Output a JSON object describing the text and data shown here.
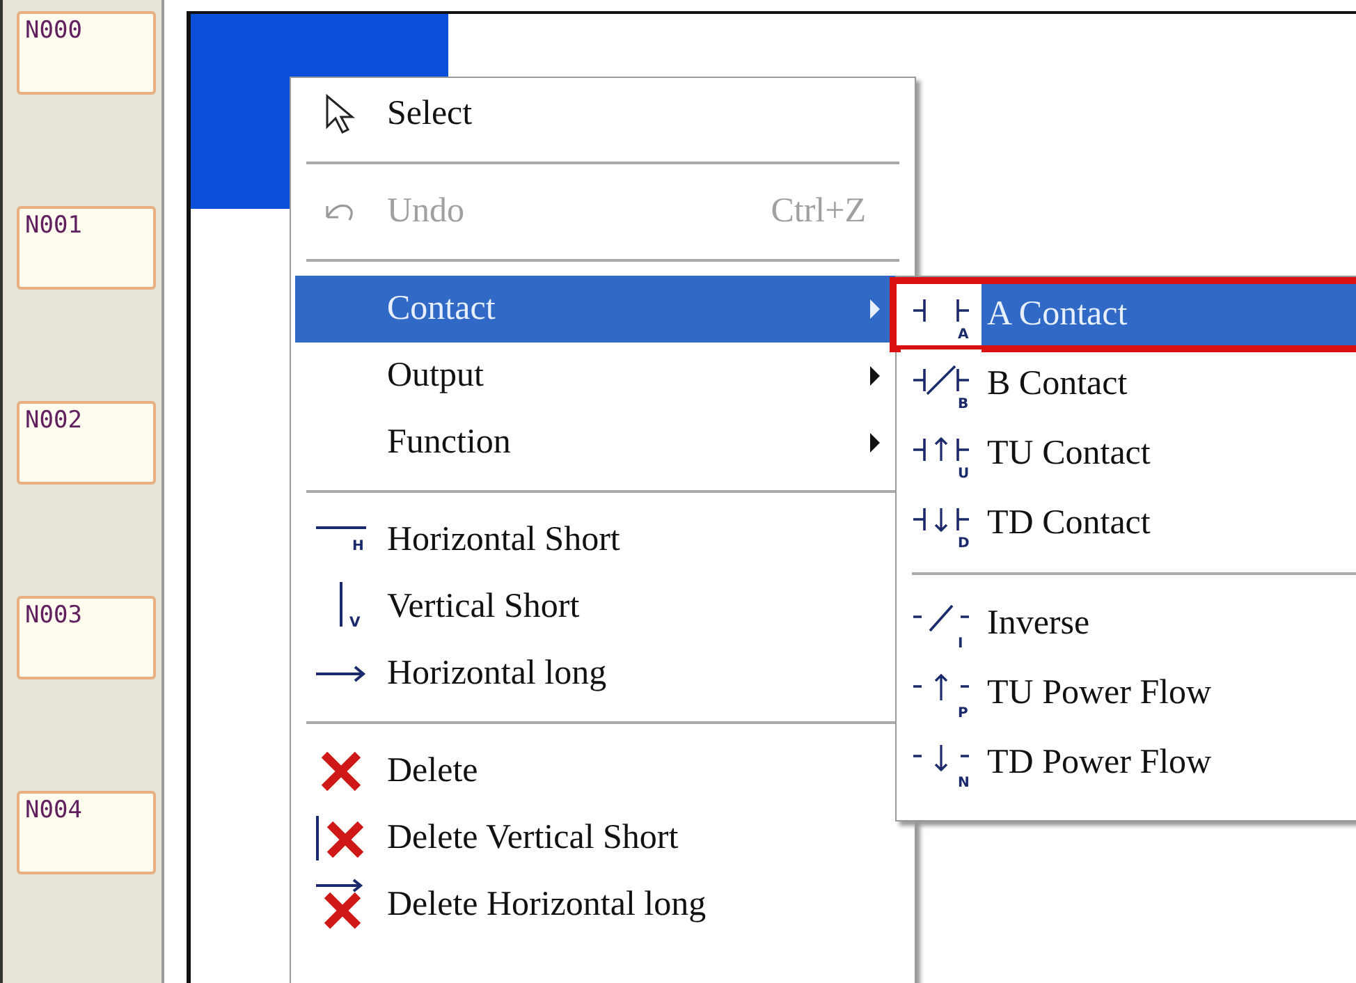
{
  "nodes": [
    {
      "label": "N000"
    },
    {
      "label": "N001"
    },
    {
      "label": "N002"
    },
    {
      "label": "N003"
    },
    {
      "label": "N004"
    }
  ],
  "canvas": {
    "cursor_selected": true
  },
  "menu": {
    "items": [
      {
        "kind": "item",
        "label": "Select",
        "disabled": false,
        "selected": false
      },
      {
        "kind": "separator"
      },
      {
        "kind": "item",
        "label": "Undo",
        "shortcut": "Ctrl+Z",
        "disabled": true,
        "selected": false
      },
      {
        "kind": "separator"
      },
      {
        "kind": "submenu",
        "label": "Contact",
        "disabled": false,
        "selected": true
      },
      {
        "kind": "submenu",
        "label": "Output",
        "disabled": false,
        "selected": false
      },
      {
        "kind": "submenu",
        "label": "Function",
        "disabled": false,
        "selected": false
      },
      {
        "kind": "separator"
      },
      {
        "kind": "item",
        "label": "Horizontal Short",
        "icon_letter": "H",
        "disabled": false,
        "selected": false
      },
      {
        "kind": "item",
        "label": "Vertical Short",
        "icon_letter": "V",
        "disabled": false,
        "selected": false
      },
      {
        "kind": "item",
        "label": "Horizontal long",
        "disabled": false,
        "selected": false
      },
      {
        "kind": "separator"
      },
      {
        "kind": "item",
        "label": "Delete",
        "disabled": false,
        "selected": false
      },
      {
        "kind": "item",
        "label": "Delete Vertical Short",
        "disabled": false,
        "selected": false
      },
      {
        "kind": "item",
        "label": "Delete Horizontal long",
        "disabled": false,
        "selected": false
      }
    ]
  },
  "submenu": {
    "items": [
      {
        "kind": "item",
        "label": "A Contact",
        "icon_letter": "A",
        "selected": true,
        "outlined": true
      },
      {
        "kind": "item",
        "label": "B Contact",
        "icon_letter": "B",
        "selected": false,
        "outlined": false
      },
      {
        "kind": "item",
        "label": "TU Contact",
        "icon_letter": "U",
        "selected": false,
        "outlined": false
      },
      {
        "kind": "item",
        "label": "TD Contact",
        "icon_letter": "D",
        "selected": false,
        "outlined": false
      },
      {
        "kind": "separator"
      },
      {
        "kind": "item",
        "label": "Inverse",
        "icon_letter": "I",
        "selected": false,
        "outlined": false
      },
      {
        "kind": "item",
        "label": "TU Power Flow",
        "icon_letter": "P",
        "selected": false,
        "outlined": false
      },
      {
        "kind": "item",
        "label": "TD Power Flow",
        "icon_letter": "N",
        "selected": false,
        "outlined": false
      }
    ]
  }
}
